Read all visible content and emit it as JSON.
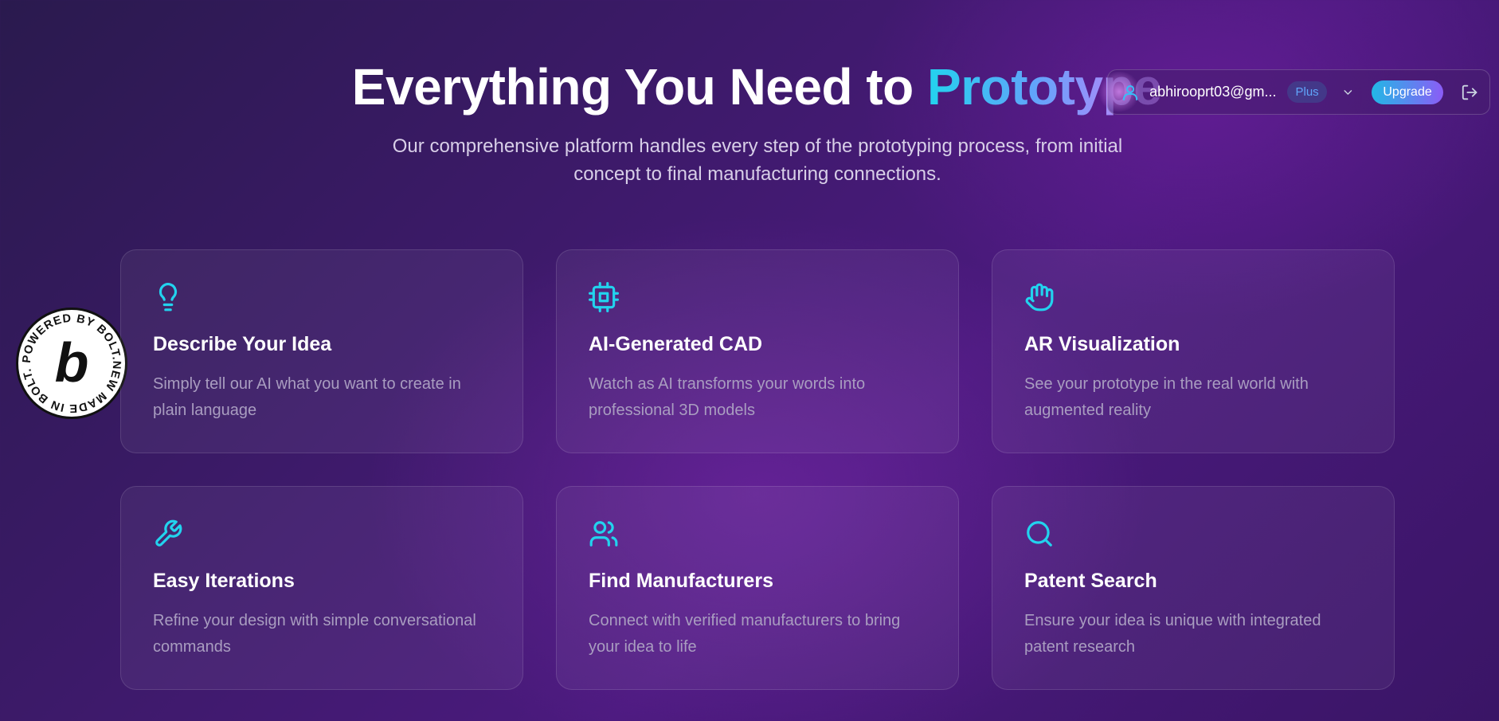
{
  "hero": {
    "title_main": "Everything You Need to ",
    "title_accent": "Prototype",
    "subtitle": "Our comprehensive platform handles every step of the prototyping process, from initial concept to final manufacturing connections."
  },
  "account": {
    "email": "abhirooprt03@gm...",
    "plan": "Plus",
    "upgrade_label": "Upgrade",
    "icons": [
      "user-icon",
      "chevron-down-icon",
      "logout-icon"
    ]
  },
  "badge": {
    "ring_text": "POWERED BY BOLT.NEW MADE IN BOLT.NEW ",
    "letter": "b"
  },
  "features": [
    {
      "title": "Describe Your Idea",
      "desc": "Simply tell our AI what you want to create in plain language",
      "icon": "lightbulb-icon"
    },
    {
      "title": "AI-Generated CAD",
      "desc": "Watch as AI transforms your words into professional 3D models",
      "icon": "cpu-icon"
    },
    {
      "title": "AR Visualization",
      "desc": "See your prototype in the real world with augmented reality",
      "icon": "hand-icon"
    },
    {
      "title": "Easy Iterations",
      "desc": "Refine your design with simple conversational commands",
      "icon": "wrench-icon"
    },
    {
      "title": "Find Manufacturers",
      "desc": "Connect with verified manufacturers to bring your idea to life",
      "icon": "users-icon"
    },
    {
      "title": "Patent Search",
      "desc": "Ensure your idea is unique with integrated patent research",
      "icon": "search-icon"
    }
  ],
  "colors": {
    "accent_cyan": "#22d3ee",
    "accent_purple": "#a78bfa",
    "icon_color": "#22d3ee"
  }
}
